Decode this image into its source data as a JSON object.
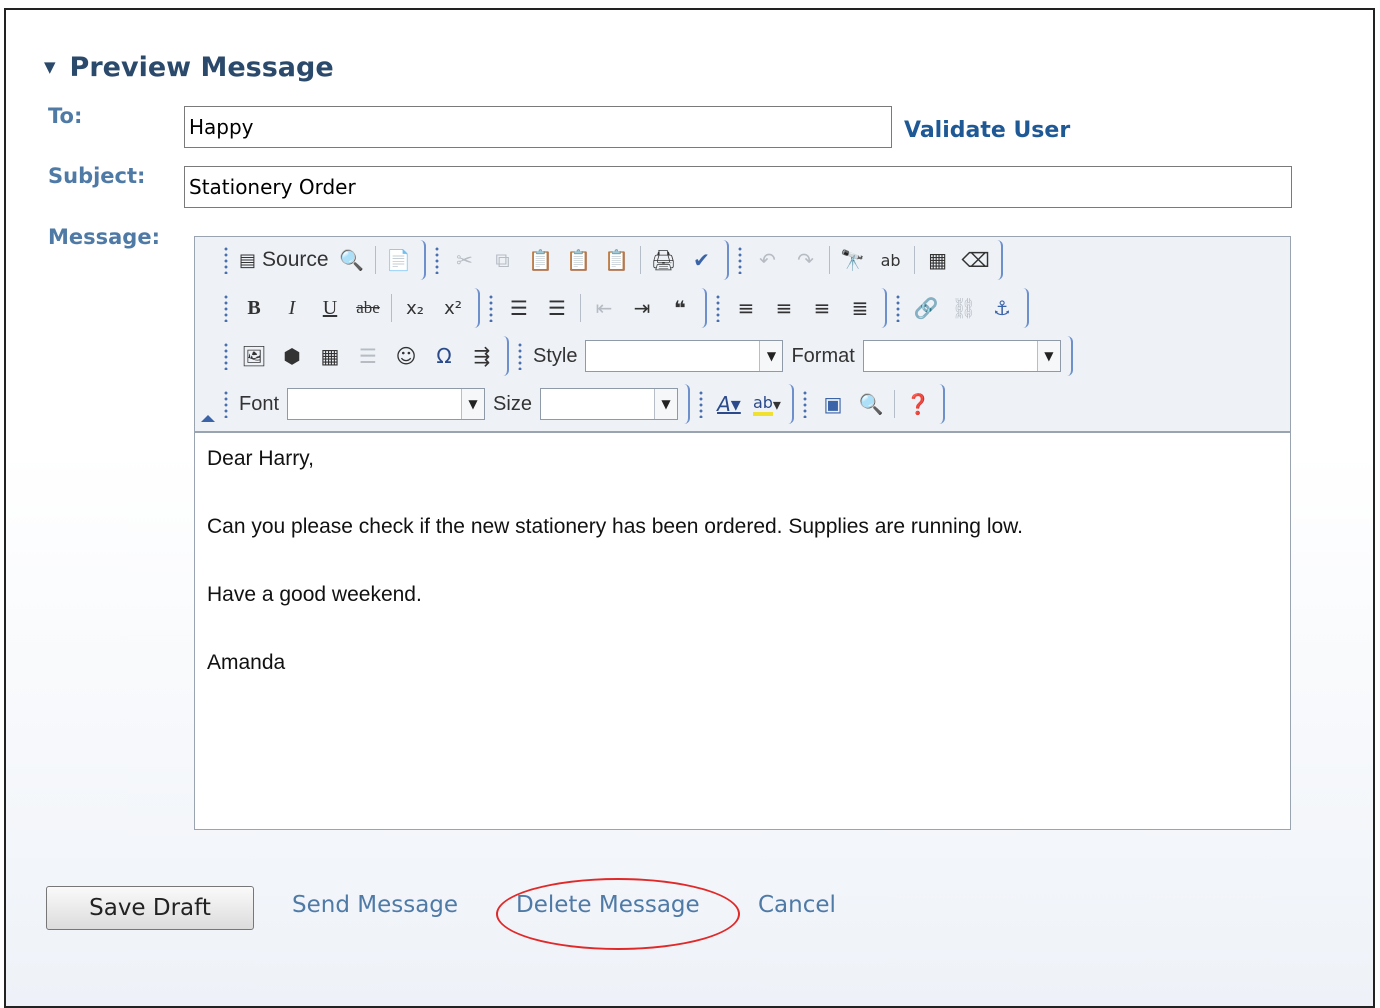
{
  "section": {
    "title": "Preview Message",
    "toggle_icon": "triangle-down-icon"
  },
  "form": {
    "to_label": "To:",
    "to_value": "Happy",
    "validate_label": "Validate User",
    "subject_label": "Subject:",
    "subject_value": "Stationery Order",
    "message_label": "Message:"
  },
  "toolbar": {
    "source_label": "Source",
    "style_label": "Style",
    "format_label": "Format",
    "font_label": "Font",
    "size_label": "Size",
    "bold": "B",
    "italic": "I",
    "underline": "U",
    "strike": "abe",
    "subscript": "x₂",
    "superscript": "x²",
    "omega": "Ω"
  },
  "message": {
    "lines": [
      "Dear Harry,",
      "Can you please check if the new stationery has been ordered. Supplies are running low.",
      "Have a good weekend.",
      "Amanda"
    ]
  },
  "actions": {
    "save_draft": "Save Draft",
    "send": "Send Message",
    "delete": "Delete Message",
    "cancel": "Cancel"
  },
  "colors": {
    "accent": "#4f7aa6",
    "link": "#1e5996",
    "highlight_circle": "#e02a2a"
  }
}
